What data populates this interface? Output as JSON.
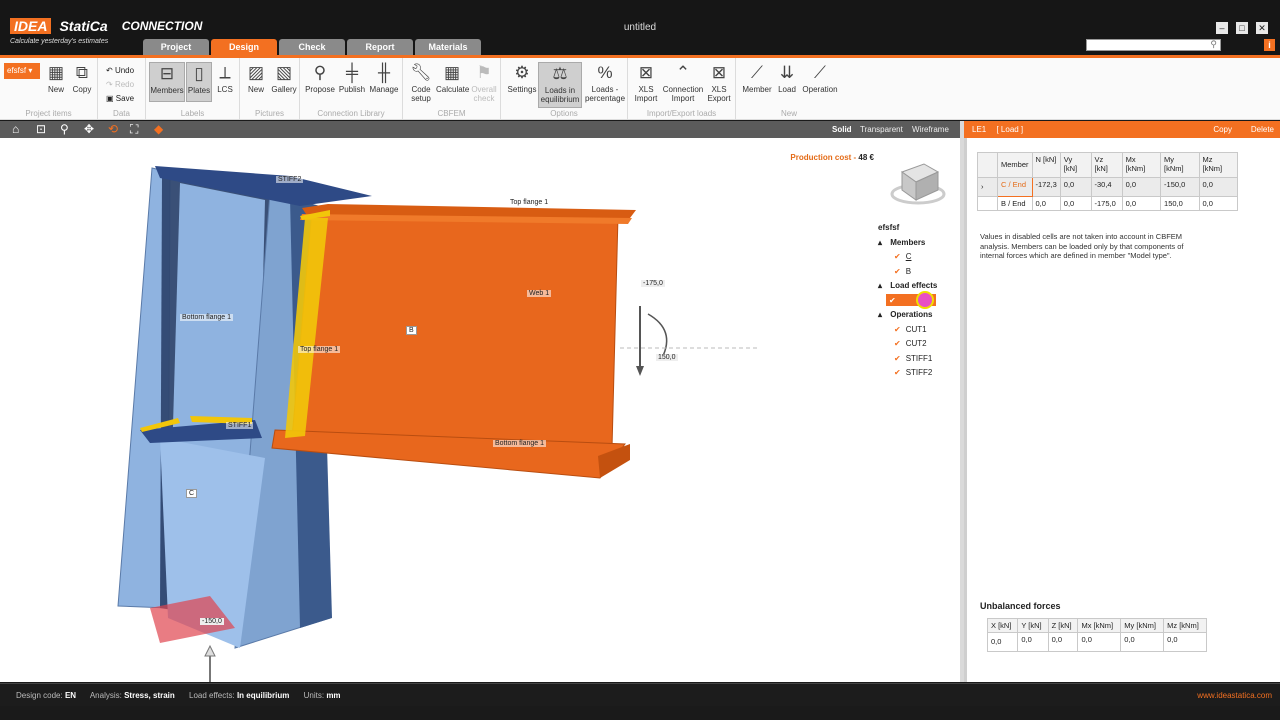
{
  "app": {
    "brand_idea": "IDEA",
    "brand_statica": "StatiCa",
    "product": "CONNECTION",
    "tagline": "Calculate yesterday's estimates",
    "window_title": "untitled"
  },
  "tabs": [
    {
      "label": "Project",
      "active": false
    },
    {
      "label": "Design",
      "active": true
    },
    {
      "label": "Check",
      "active": false
    },
    {
      "label": "Report",
      "active": false
    },
    {
      "label": "Materials",
      "active": false
    }
  ],
  "ribbon": {
    "project_items": {
      "selector": "efsfsf",
      "new": "New",
      "copy": "Copy",
      "group": "Project items"
    },
    "data": {
      "undo": "Undo",
      "redo": "Redo",
      "save": "Save",
      "group": "Data"
    },
    "labels": {
      "members": "Members",
      "plates": "Plates",
      "lcs": "LCS",
      "group": "Labels"
    },
    "pictures": {
      "new": "New",
      "gallery": "Gallery",
      "group": "Pictures"
    },
    "connection_library": {
      "propose": "Propose",
      "publish": "Publish",
      "manage": "Manage",
      "group": "Connection Library"
    },
    "cbfem": {
      "code_setup": "Code setup",
      "calculate": "Calculate",
      "overall_check": "Overall check",
      "group": "CBFEM"
    },
    "options": {
      "settings": "Settings",
      "loads_eq": "Loads in equilibrium",
      "loads_pct": "Loads - percentage",
      "group": "Options"
    },
    "import_export": {
      "xls_import": "XLS Import",
      "conn_import": "Connection Import",
      "xls_export": "XLS Export",
      "group": "Import/Export loads"
    },
    "new_group": {
      "member": "Member",
      "load": "Load",
      "operation": "Operation",
      "group": "New"
    }
  },
  "view_modes": {
    "solid": "Solid",
    "transparent": "Transparent",
    "wireframe": "Wireframe"
  },
  "viewport": {
    "production_cost_label": "Production cost",
    "production_cost_value": "48 €",
    "labels3d": {
      "stiff2": "STIFF2",
      "top_flange_b": "Top flange 1",
      "web_b": "Web 1",
      "member_b": "B",
      "bottom_flange_c": "Bottom flange 1",
      "top_flange_c": "Top flange 1",
      "stiff1": "STIFF1",
      "bottom_flange_b": "Bottom flange 1",
      "member_c": "C",
      "load_vz": "-175,0",
      "load_my": "150,0",
      "load_n": "-150,0"
    }
  },
  "tree": {
    "root": "efsfsf",
    "members_label": "Members",
    "members": [
      "C",
      "B"
    ],
    "load_effects_label": "Load effects",
    "operations_label": "Operations",
    "operations": [
      "CUT1",
      "CUT2",
      "STIFF1",
      "STIFF2"
    ]
  },
  "right_panel": {
    "title": "LE1",
    "subtitle": "[ Load ]",
    "copy": "Copy",
    "delete": "Delete",
    "table_headers": [
      "Member",
      "N [kN]",
      "Vy [kN]",
      "Vz [kN]",
      "Mx [kNm]",
      "My [kNm]",
      "Mz [kNm]"
    ],
    "rows": [
      [
        "C / End",
        "-172,3",
        "0,0",
        "-30,4",
        "0,0",
        "-150,0",
        "0,0"
      ],
      [
        "B / End",
        "0,0",
        "0,0",
        "-175,0",
        "0,0",
        "150,0",
        "0,0"
      ]
    ],
    "note": "Values in disabled cells are not taken into account in CBFEM analysis. Members can be loaded only by that components of internal forces which are defined in member \"Model type\".",
    "unbalanced_title": "Unbalanced forces",
    "unbalanced_headers": [
      "X [kN]",
      "Y [kN]",
      "Z [kN]",
      "Mx [kNm]",
      "My [kNm]",
      "Mz [kNm]"
    ],
    "unbalanced_values": [
      "0,0",
      "0,0",
      "0,0",
      "0,0",
      "0,0",
      "0,0"
    ]
  },
  "status": {
    "design_code_label": "Design code:",
    "design_code": "EN",
    "analysis_label": "Analysis:",
    "analysis": "Stress, strain",
    "load_effects_label": "Load effects:",
    "load_effects": "In equilibrium",
    "units_label": "Units:",
    "units": "mm",
    "website": "www.ideastatica.com"
  },
  "colors": {
    "accent": "#f37021",
    "column": "#8fb3e0",
    "beam": "#e8671d",
    "plate": "#2e4a86"
  }
}
